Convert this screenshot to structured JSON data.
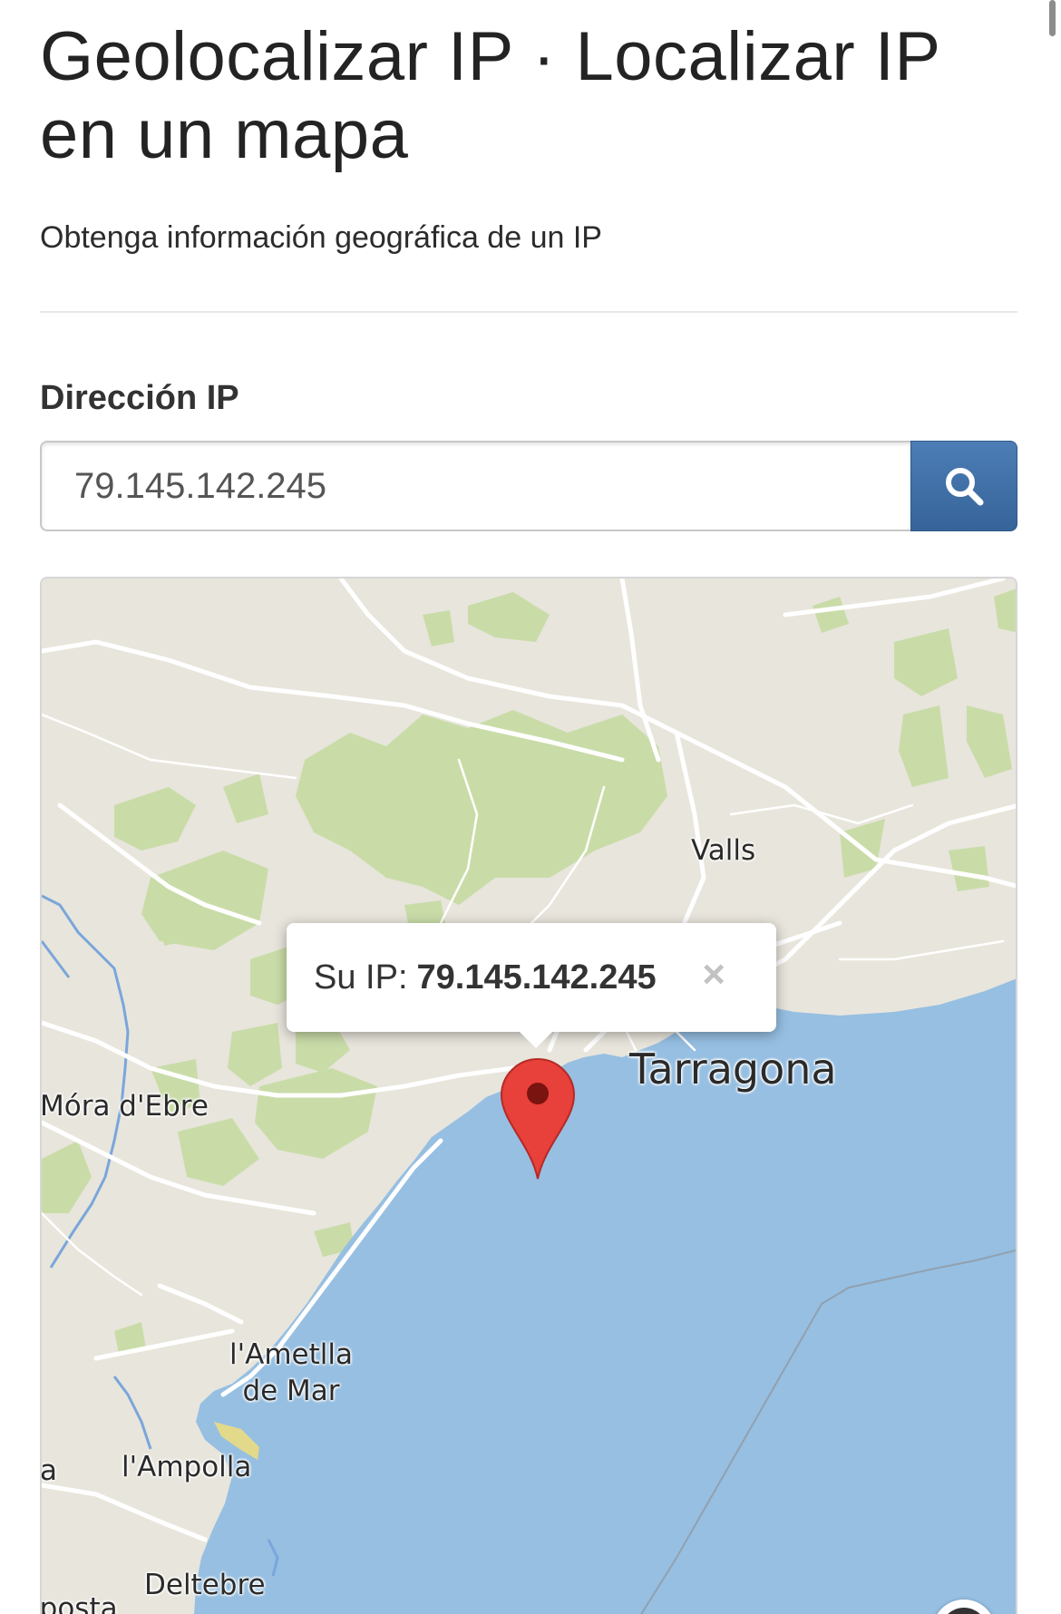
{
  "header": {
    "title": "Geolocalizar IP · Localizar IP en un mapa",
    "subtitle": "Obtenga información geográfica de un IP"
  },
  "form": {
    "label": "Dirección IP",
    "ip_value": "79.145.142.245",
    "search_icon": "search-icon"
  },
  "map": {
    "popup": {
      "label": "Su IP:",
      "ip": "79.145.142.245",
      "close": "×"
    },
    "places": {
      "valls": "Valls",
      "tarragona": "Tarragona",
      "mora": "Móra d'Ebre",
      "ametlla": "l'Ametlla de Mar",
      "ampolla": "l'Ampolla",
      "a": "a",
      "deltebre": "Deltebre",
      "aposta": "nposta"
    },
    "marker_icon": "map-pin-icon",
    "info_icon": "info-icon",
    "info_symbol": "i",
    "colors": {
      "land": "#e8e5dc",
      "sea": "#96bfe2",
      "forest": "#c9dca8",
      "roads": "#ffffff",
      "rivers": "#7aa6da",
      "marker": "#e8403a"
    }
  }
}
